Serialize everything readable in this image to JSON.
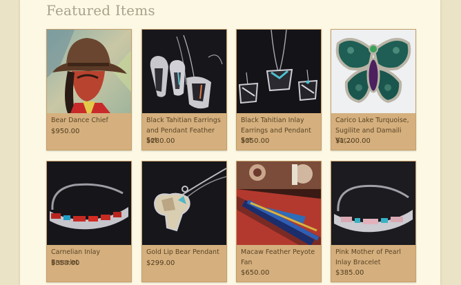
{
  "section": {
    "title": "Featured Items"
  },
  "items": [
    {
      "name": "Bear Dance Chief",
      "price": "$950.00",
      "image": "painting-thumbnail"
    },
    {
      "name": "Black Tahitian Earrings and Pendant Feather Set",
      "price": "$280.00",
      "image": "jewelry-set-thumbnail"
    },
    {
      "name": "Black Tahitian Inlay Earrings and Pendant Set",
      "price": "$350.00",
      "image": "jewelry-set-thumbnail"
    },
    {
      "name": "Carico Lake Turquoise, Sugilite and Damaili Var...",
      "price": "$1,200.00",
      "image": "butterfly-pin-thumbnail"
    },
    {
      "name": "Carnelian Inlay Bracelet",
      "price": "$350.00",
      "image": "bracelet-thumbnail"
    },
    {
      "name": "Gold Lip Bear Pendant",
      "price": "$299.00",
      "image": "pendant-thumbnail"
    },
    {
      "name": "Macaw Feather Peyote Fan",
      "price": "$650.00",
      "image": "feather-fan-thumbnail"
    },
    {
      "name": "Pink Mother of Pearl Inlay Bracelet",
      "price": "$385.00",
      "image": "bracelet-thumbnail"
    }
  ]
}
